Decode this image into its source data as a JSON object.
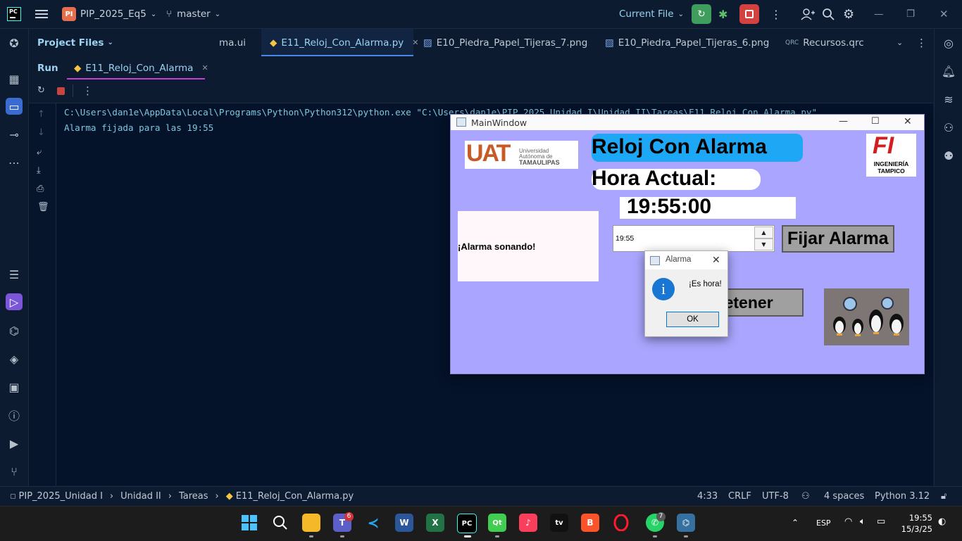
{
  "app": {
    "project_badge": "PI",
    "project_name": "PIP_2025_Eq5",
    "branch": "master",
    "run_config": "Current File"
  },
  "tabs": {
    "project_files": "Project Files",
    "items": [
      {
        "label": "ma.ui"
      },
      {
        "label": "E11_Reloj_Con_Alarma.py"
      },
      {
        "label": "E10_Piedra_Papel_Tijeras_7.png"
      },
      {
        "label": "E10_Piedra_Papel_Tijeras_6.png"
      },
      {
        "label": "Recursos.qrc",
        "prefix": "QRC"
      }
    ]
  },
  "run_panel": {
    "title": "Run",
    "config_tab": "E11_Reloj_Con_Alarma"
  },
  "console": {
    "lines": [
      "C:\\Users\\dan1e\\AppData\\Local\\Programs\\Python\\Python312\\python.exe \"C:\\Users\\dan1e\\PIP_2025_Unidad I\\Unidad II\\Tareas\\E11_Reloj_Con_Alarma.py\"",
      "Alarma fijada para las 19:55"
    ]
  },
  "main_window": {
    "title": "MainWindow",
    "uat_logo": {
      "big": "UAT",
      "line1": "Universidad",
      "line2": "Autónoma de",
      "line3": "TAMAULIPAS"
    },
    "fi_logo": {
      "big": "FI",
      "line1": "INGENIERÍA",
      "line2": "TAMPICO"
    },
    "heading": "Reloj Con Alarma",
    "hora_label": "Hora Actual:",
    "time": "19:55:00",
    "alarm_status": "¡Alarma sonando!",
    "time_edit_value": "19:55",
    "set_button": "Fijar Alarma",
    "stop_button": "Detener"
  },
  "dialog": {
    "title": "Alarma",
    "message": "¡Es hora!",
    "ok": "OK"
  },
  "statusbar": {
    "crumbs": [
      "PIP_2025_Unidad I",
      "Unidad II",
      "Tareas",
      "E11_Reloj_Con_Alarma.py"
    ],
    "position": "4:33",
    "line_sep": "CRLF",
    "encoding": "UTF-8",
    "indent": "4 spaces",
    "interpreter": "Python 3.12"
  },
  "taskbar": {
    "teams_badge": "6",
    "whatsapp_badge": "7",
    "language": "ESP",
    "time": "19:55",
    "date": "15/3/25",
    "tv_label": "tv"
  },
  "colors": {
    "ide_bg": "#0b1a2e",
    "console_bg": "#04122a",
    "console_text": "#7ec8de",
    "qt_window_bg": "#aaa6ff",
    "heading_bg": "#1ea7f5",
    "run_green": "#3f9d5e",
    "stop_red": "#d4423f"
  }
}
